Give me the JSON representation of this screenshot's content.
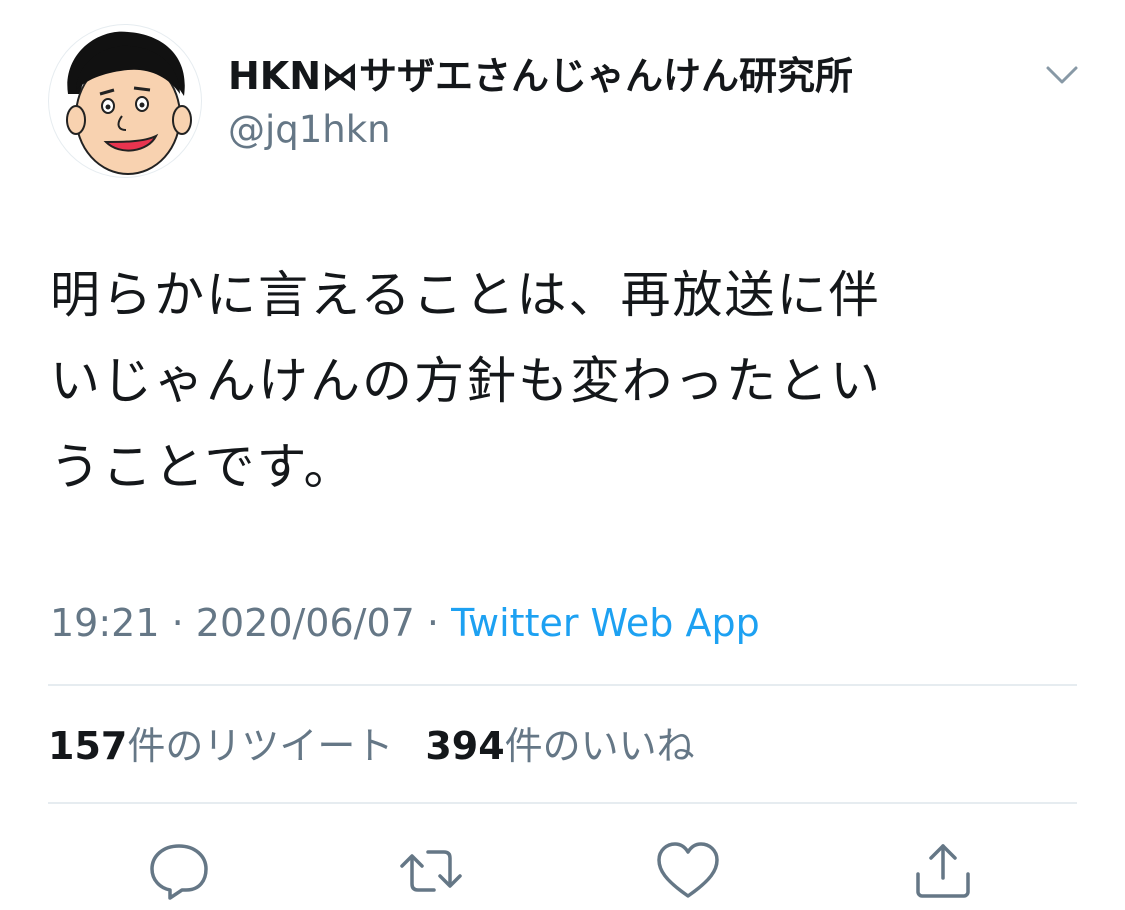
{
  "tweet": {
    "author": {
      "display_name": "HKN⋈サザエさんじゃんけん研究所",
      "handle": "@jq1hkn",
      "avatar_icon": "cartoon-face-avatar"
    },
    "text": "明らかに言えることは、再放送に伴\nいじゃんけんの方針も変わったとい\nうことです。",
    "time": "19:21",
    "separator": "·",
    "date": "2020/06/07",
    "source": "Twitter Web App",
    "retweets": {
      "count": "157",
      "label": "件のリツイート"
    },
    "likes": {
      "count": "394",
      "label": "件のいいね"
    }
  },
  "actions": [
    {
      "name": "reply",
      "icon": "speech-bubble-icon"
    },
    {
      "name": "retweet",
      "icon": "retweet-arrows-icon"
    },
    {
      "name": "like",
      "icon": "heart-icon"
    },
    {
      "name": "share",
      "icon": "share-upload-icon"
    }
  ],
  "colors": {
    "text": "#14171a",
    "secondary": "#657786",
    "accent": "#1da1f2",
    "divider": "#e6ecf0"
  }
}
